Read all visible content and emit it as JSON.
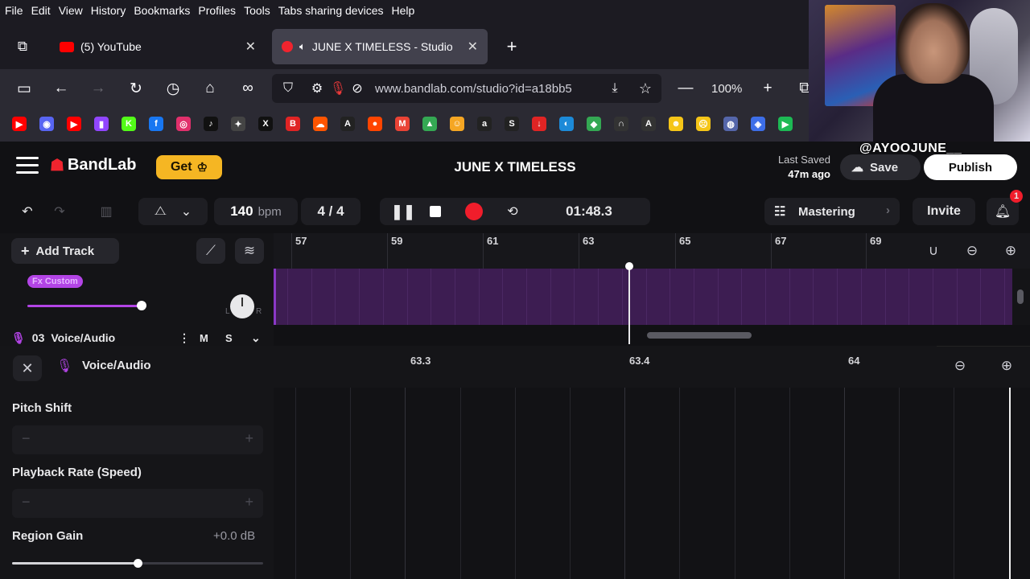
{
  "menu": [
    "File",
    "Edit",
    "View",
    "History",
    "Bookmarks",
    "Profiles",
    "Tools",
    "Tabs sharing devices",
    "Help"
  ],
  "tabs": [
    {
      "label": "(5) YouTube"
    },
    {
      "label": "JUNE X TIMELESS - Studio"
    }
  ],
  "nav": {
    "url": "www.bandlab.com/studio?id=a18bb5",
    "zoom": "100%"
  },
  "bookmarks": [
    {
      "icon": "youtube-icon",
      "color": "#ff0000",
      "glyph": "▶"
    },
    {
      "icon": "discord-icon",
      "color": "#5865f2",
      "glyph": "◉"
    },
    {
      "icon": "youtube-icon",
      "color": "#ff0000",
      "glyph": "▶"
    },
    {
      "icon": "twitch-icon",
      "color": "#9146ff",
      "glyph": "▮"
    },
    {
      "icon": "kick-icon",
      "color": "#53fc18",
      "glyph": "K"
    },
    {
      "icon": "facebook-icon",
      "color": "#1877f2",
      "glyph": "f"
    },
    {
      "icon": "instagram-icon",
      "color": "#e1306c",
      "glyph": "◎"
    },
    {
      "icon": "tiktok-icon",
      "color": "#111111",
      "glyph": "♪"
    },
    {
      "icon": "streamlabs-icon",
      "color": "#444444",
      "glyph": "✦"
    },
    {
      "icon": "x-icon",
      "color": "#111111",
      "glyph": "X"
    },
    {
      "icon": "bookmark-red-icon",
      "color": "#e02424",
      "glyph": "B"
    },
    {
      "icon": "soundcloud-icon",
      "color": "#ff5500",
      "glyph": "☁"
    },
    {
      "icon": "font-a-icon",
      "color": "#222222",
      "glyph": "A"
    },
    {
      "icon": "reddit-icon",
      "color": "#ff4500",
      "glyph": "●"
    },
    {
      "icon": "gmail-icon",
      "color": "#ea4335",
      "glyph": "M"
    },
    {
      "icon": "drive-icon",
      "color": "#34a853",
      "glyph": "▲"
    },
    {
      "icon": "app-icon",
      "color": "#f5a623",
      "glyph": "☺"
    },
    {
      "icon": "amazon-icon",
      "color": "#222222",
      "glyph": "a"
    },
    {
      "icon": "s-icon",
      "color": "#222222",
      "glyph": "S"
    },
    {
      "icon": "download-icon",
      "color": "#e02424",
      "glyph": "↓"
    },
    {
      "icon": "edge-icon",
      "color": "#1c8ad8",
      "glyph": "◐"
    },
    {
      "icon": "map-icon",
      "color": "#34a853",
      "glyph": "◆"
    },
    {
      "icon": "headphones-icon",
      "color": "#333333",
      "glyph": "∩"
    },
    {
      "icon": "a-circle-icon",
      "color": "#333333",
      "glyph": "A"
    },
    {
      "icon": "emoji-icon",
      "color": "#f5c518",
      "glyph": "☻"
    },
    {
      "icon": "emoji-icon",
      "color": "#f5c518",
      "glyph": "☹"
    },
    {
      "icon": "globe-icon",
      "color": "#5566aa",
      "glyph": "◍"
    },
    {
      "icon": "blue-app-icon",
      "color": "#3d6ee8",
      "glyph": "◈"
    },
    {
      "icon": "play-green-icon",
      "color": "#1db954",
      "glyph": "▶"
    }
  ],
  "header": {
    "brand": "BandLab",
    "get_label": "Get",
    "project_title": "JUNE X TIMELESS",
    "last_saved_label": "Last Saved",
    "last_saved_time": "47m ago",
    "save_label": "Save",
    "publish_label": "Publish",
    "stream_tag": "@AYOOJUNE__"
  },
  "transport": {
    "bpm": "140",
    "bpm_unit": "bpm",
    "time_sig": "4 / 4",
    "time": "01:48.3",
    "mastering_label": "Mastering",
    "invite_label": "Invite",
    "notifications_count": "1"
  },
  "tracks": {
    "add_label": "Add Track",
    "fx_tag": "Fx Custom",
    "pan_l": "L",
    "pan_r": "R",
    "track_number": "03",
    "track_name": "Voice/Audio",
    "mute": "M",
    "solo": "S"
  },
  "ruler": [
    "57",
    "59",
    "61",
    "63",
    "65",
    "67",
    "69"
  ],
  "editor": {
    "title": "Voice/Audio",
    "ruler": [
      "63.3",
      "63.4",
      "64"
    ],
    "pitch_label": "Pitch Shift",
    "rate_label": "Playback Rate (Speed)",
    "gain_label": "Region Gain",
    "gain_value": "+0.0 dB",
    "gain_position": 0.5
  }
}
